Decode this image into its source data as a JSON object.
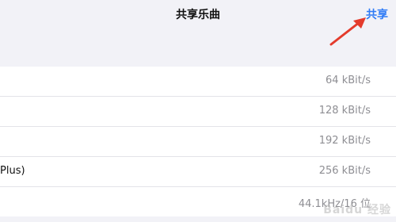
{
  "nav": {
    "title": "共享乐曲",
    "action_label": "共享"
  },
  "colors": {
    "accent": "#2f7bf6",
    "arrow": "#e43b2c"
  },
  "rows": [
    {
      "label": "",
      "value": "64 kBit/s"
    },
    {
      "label": "",
      "value": "128 kBit/s"
    },
    {
      "label": "",
      "value": "192 kBit/s"
    },
    {
      "label": "Plus)",
      "value": "256 kBit/s"
    },
    {
      "label": "",
      "value": "44.1kHz/16 位"
    }
  ],
  "watermark": "Baidu 经验"
}
